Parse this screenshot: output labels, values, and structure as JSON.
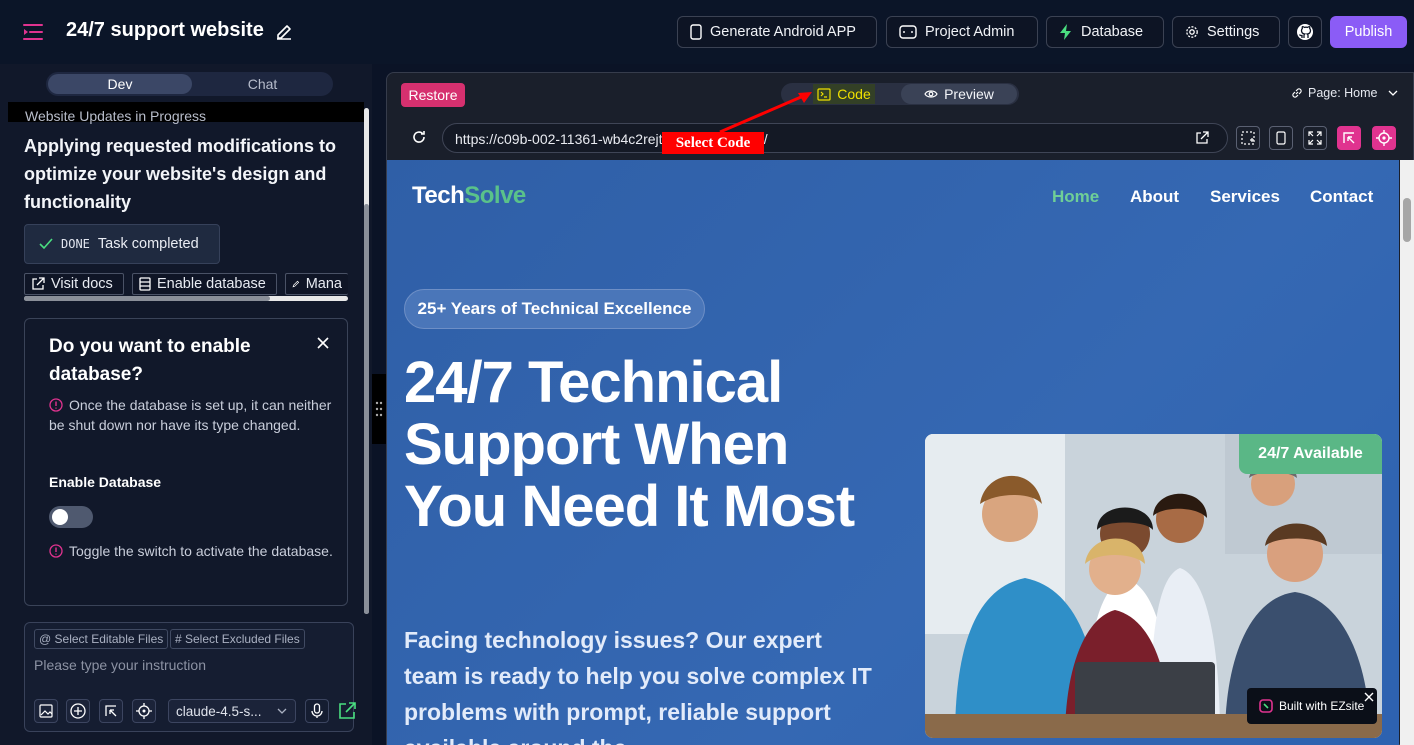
{
  "app": {
    "title": "24/7 support website",
    "toolbar": {
      "android": "Generate Android APP",
      "admin": "Project Admin",
      "database": "Database",
      "settings": "Settings",
      "publish": "Publish"
    }
  },
  "left": {
    "tabs": {
      "dev": "Dev",
      "chat": "Chat"
    },
    "update_banner": "Website Updates in Progress",
    "lead": "Applying requested modifications to optimize your website's design and functionality",
    "done": {
      "label": "DONE",
      "text": "Task completed"
    },
    "quick_actions": [
      "Visit docs",
      "Enable database",
      "Mana"
    ],
    "db_card": {
      "title": "Do you want to enable database?",
      "warning": "Once the database is set up, it can neither be shut down nor have its type changed.",
      "enable_label": "Enable Database",
      "hint": "Toggle the switch to activate the database.",
      "toggle_on": false
    },
    "instruction": {
      "chip_editable": "@ Select Editable Files",
      "chip_excluded": "# Select Excluded Files",
      "placeholder": "Please type your instruction",
      "model": "claude-4.5-s..."
    }
  },
  "right": {
    "restore": "Restore",
    "tabs": {
      "code": "Code",
      "preview": "Preview"
    },
    "page_selector": "Page: Home",
    "url": "https://c09b-002-11361-wb4c2rejternal.easysite.ai/",
    "annotation": "Select Code",
    "colors": {
      "accent": "#8b5cf6",
      "restore": "#d6306f",
      "pink_tool": "#e0338f"
    }
  },
  "site": {
    "logo_a": "Tech",
    "logo_b": "Solve",
    "nav": [
      "Home",
      "About",
      "Services",
      "Contact"
    ],
    "badge": "25+ Years of Technical Excellence",
    "hero_title": "24/7 Technical Support When You Need It Most",
    "hero_desc": "Facing technology issues? Our expert team is ready to help you solve complex IT problems with prompt, reliable support available around the",
    "available": "24/7 Available",
    "built_with": "Built with EZsite"
  }
}
